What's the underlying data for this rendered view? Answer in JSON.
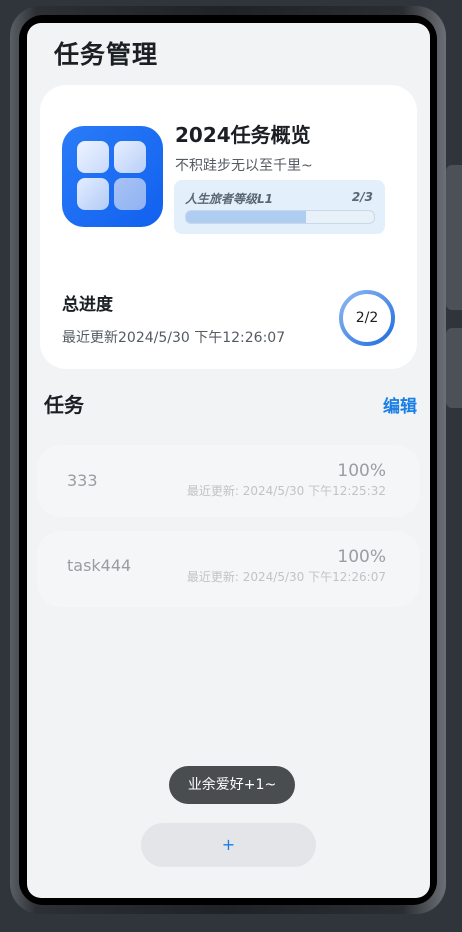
{
  "page": {
    "title": "任务管理"
  },
  "overview": {
    "title": "2024任务概览",
    "subtitle": "不积跬步无以至千里~",
    "level": {
      "label": "人生旅者等级L1",
      "count": "2/3",
      "progress": 0.64
    },
    "total": {
      "label": "总进度",
      "updated": "最近更新2024/5/30 下午12:26:07",
      "ring_text": "2/2",
      "progress": 1.0
    }
  },
  "tasks": {
    "title": "任务",
    "edit_label": "编辑",
    "items": [
      {
        "name": "333",
        "percent": "100%",
        "updated": "最近更新: 2024/5/30 下午12:25:32"
      },
      {
        "name": "task444",
        "percent": "100%",
        "updated": "最近更新: 2024/5/30 下午12:26:07"
      }
    ]
  },
  "toast": {
    "text": "业余爱好+1~"
  },
  "add_button": {
    "label": "+"
  },
  "colors": {
    "accent": "#1a7ee6",
    "ring_start": "#1f6de0",
    "ring_end": "#8fb8f2"
  }
}
